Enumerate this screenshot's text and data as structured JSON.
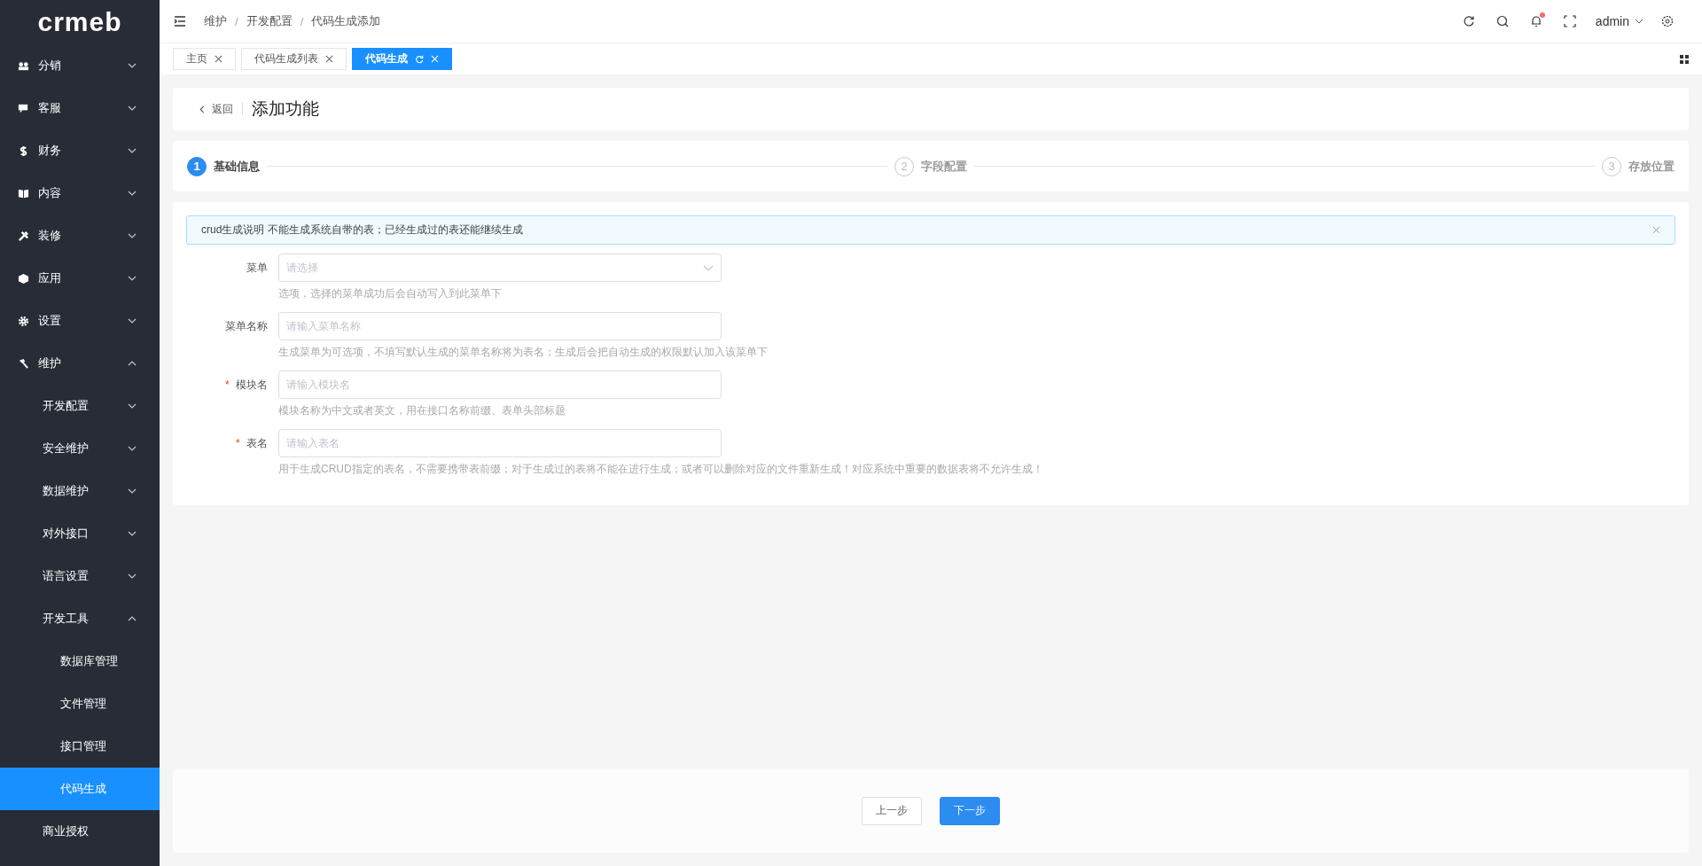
{
  "sidebar": {
    "logo": "crmeb",
    "items": [
      {
        "label": "分销",
        "expanded": false,
        "selected": false
      },
      {
        "label": "客服",
        "expanded": false,
        "selected": false
      },
      {
        "label": "财务",
        "expanded": false,
        "selected": false
      },
      {
        "label": "内容",
        "expanded": false,
        "selected": false
      },
      {
        "label": "装修",
        "expanded": false,
        "selected": false
      },
      {
        "label": "应用",
        "expanded": false,
        "selected": false
      },
      {
        "label": "设置",
        "expanded": false,
        "selected": false
      },
      {
        "label": "维护",
        "expanded": true,
        "selected": false,
        "children": [
          {
            "label": "开发配置",
            "expanded": false,
            "selected": false
          },
          {
            "label": "安全维护",
            "expanded": false,
            "selected": false
          },
          {
            "label": "数据维护",
            "expanded": false,
            "selected": false
          },
          {
            "label": "对外接口",
            "expanded": false,
            "selected": false
          },
          {
            "label": "语言设置",
            "expanded": false,
            "selected": false
          },
          {
            "label": "开发工具",
            "expanded": true,
            "selected": false,
            "children": [
              {
                "label": "数据库管理",
                "selected": false
              },
              {
                "label": "文件管理",
                "selected": false
              },
              {
                "label": "接口管理",
                "selected": false
              },
              {
                "label": "代码生成",
                "selected": true
              }
            ]
          },
          {
            "label": "商业授权",
            "selected": false
          }
        ]
      }
    ]
  },
  "header": {
    "breadcrumb": [
      "维护",
      "开发配置",
      "代码生成添加"
    ],
    "breadcrumb_separator": "/",
    "user": "admin",
    "notification_dot": true
  },
  "tabs": [
    {
      "label": "主页",
      "selected": false
    },
    {
      "label": "代码生成列表",
      "selected": false
    },
    {
      "label": "代码生成",
      "selected": true
    }
  ],
  "page_header": {
    "back": "返回",
    "title": "添加功能"
  },
  "steps": [
    {
      "number": "1",
      "title": "基础信息",
      "active": true
    },
    {
      "number": "2",
      "title": "字段配置",
      "active": false
    },
    {
      "number": "3",
      "title": "存放位置",
      "active": false
    }
  ],
  "alert": {
    "text": "crud生成说明 不能生成系统自带的表；已经生成过的表还能继续生成"
  },
  "required_mark": "*",
  "form": [
    {
      "label": "菜单",
      "kind": "select",
      "required": false,
      "placeholder": "请选择",
      "help": "选项，选择的菜单成功后会自动写入到此菜单下"
    },
    {
      "label": "菜单名称",
      "kind": "text",
      "required": false,
      "placeholder": "请输入菜单名称",
      "help": "生成菜单为可选项，不填写默认生成的菜单名称将为表名；生成后会把自动生成的权限默认加入该菜单下"
    },
    {
      "label": "模块名",
      "kind": "text",
      "required": true,
      "placeholder": "请输入模块名",
      "help": "模块名称为中文或者英文，用在接口名称前缀、表单头部标题"
    },
    {
      "label": "表名",
      "kind": "text",
      "required": true,
      "placeholder": "请输入表名",
      "help": "用于生成CRUD指定的表名，不需要携带表前缀；对于生成过的表将不能在进行生成；或者可以删除对应的文件重新生成！对应系统中重要的数据表将不允许生成！"
    }
  ],
  "footer": [
    {
      "label": "上一步",
      "kind": "default"
    },
    {
      "label": "下一步",
      "kind": "primary"
    }
  ]
}
